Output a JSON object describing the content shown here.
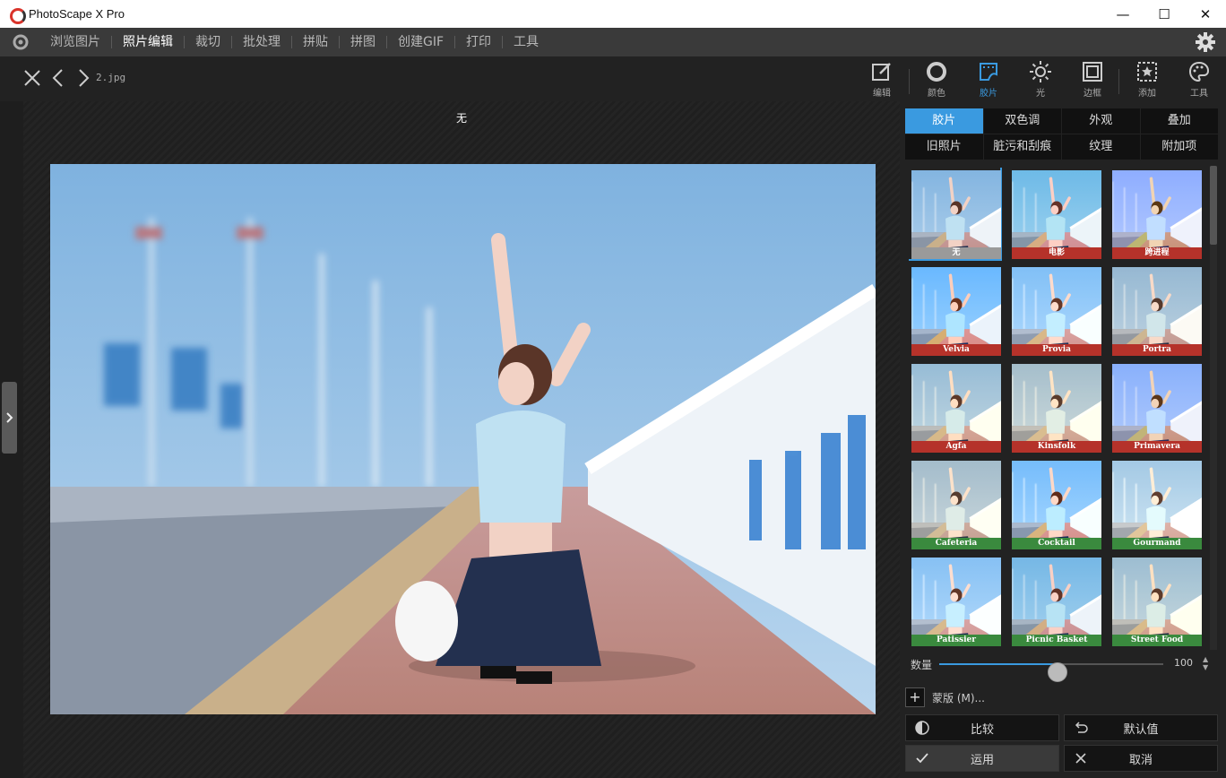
{
  "app": {
    "title": "PhotoScape X Pro"
  },
  "window_controls": {
    "minimize": "—",
    "maximize": "☐",
    "close": "✕"
  },
  "menu": {
    "items": [
      "浏览图片",
      "照片编辑",
      "裁切",
      "批处理",
      "拼贴",
      "拼图",
      "创建GIF",
      "打印",
      "工具"
    ],
    "active_index": 1
  },
  "file": {
    "name": "2.jpg"
  },
  "tools": [
    "编辑",
    "颜色",
    "胶片",
    "光",
    "边框",
    "添加",
    "工具"
  ],
  "active_tool_index": 2,
  "canvas": {
    "filter_name": "无"
  },
  "tabs_row1": [
    "胶片",
    "双色调",
    "外观",
    "叠加"
  ],
  "tabs_row2": [
    "旧照片",
    "脏污和刮痕",
    "纹理",
    "附加项"
  ],
  "active_tab_index": 0,
  "colors": {
    "accent": "#3a9ae0",
    "label_red": "#b5322a",
    "label_green": "#3a8a3e",
    "label_gray": "#9a9a9a"
  },
  "thumbnails": [
    {
      "label": "无",
      "color": "gray",
      "tint": "none"
    },
    {
      "label": "电影",
      "color": "red",
      "tint": "cinema"
    },
    {
      "label": "跨进程",
      "color": "red",
      "tint": "cross"
    },
    {
      "label": "Velvia",
      "color": "red",
      "tint": "velvia"
    },
    {
      "label": "Provia",
      "color": "red",
      "tint": "provia"
    },
    {
      "label": "Portra",
      "color": "red",
      "tint": "portra"
    },
    {
      "label": "Agfa",
      "color": "red",
      "tint": "agfa"
    },
    {
      "label": "Kinsfolk",
      "color": "red",
      "tint": "kinsfolk"
    },
    {
      "label": "Primavera",
      "color": "red",
      "tint": "primavera"
    },
    {
      "label": "Cafeteria",
      "color": "green",
      "tint": "cafeteria"
    },
    {
      "label": "Cocktail",
      "color": "green",
      "tint": "cocktail"
    },
    {
      "label": "Gourmand",
      "color": "green",
      "tint": "gourmand"
    },
    {
      "label": "Patissier",
      "color": "green",
      "tint": "patissier"
    },
    {
      "label": "Picnic Basket",
      "color": "green",
      "tint": "picnic"
    },
    {
      "label": "Street Food",
      "color": "green",
      "tint": "street"
    }
  ],
  "amount": {
    "label": "数量",
    "value": "100",
    "level": 1.0
  },
  "mask": {
    "plus": "+",
    "label": "蒙版 (M)..."
  },
  "buttons": {
    "compare": "比较",
    "default": "默认值",
    "apply": "运用",
    "cancel": "取消"
  }
}
